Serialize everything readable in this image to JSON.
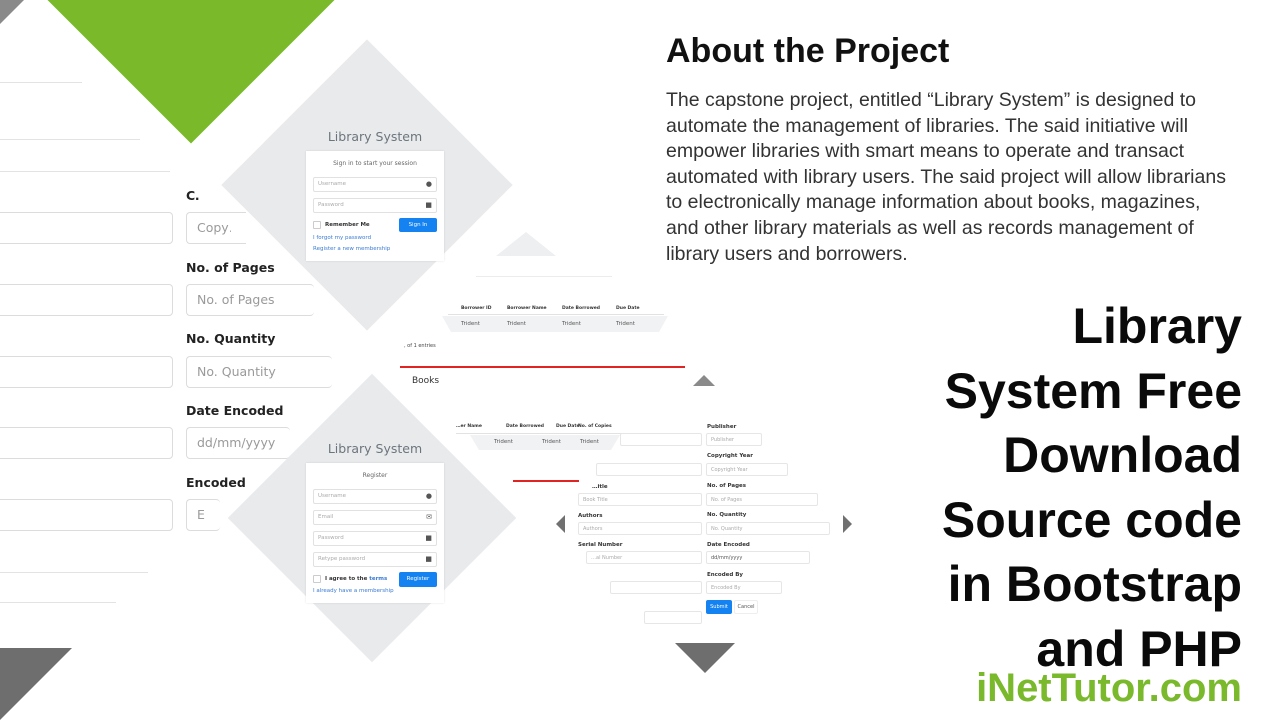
{
  "colors": {
    "accent_green": "#7ab929",
    "diamond_gray": "#e9eaec",
    "primary_blue": "#1482f0",
    "arrow_gray": "#707070",
    "red_line": "#e02424"
  },
  "left_form": {
    "fields": [
      {
        "label": "C…",
        "placeholder": "Copy…"
      },
      {
        "label": "No. of Pages",
        "placeholder": "No. of Pages"
      },
      {
        "label": "No. Quantity",
        "placeholder": "No. Quantity"
      },
      {
        "label": "Date Encoded",
        "placeholder": "dd/mm/yyyy"
      },
      {
        "label": "Encoded",
        "placeholder": "E"
      }
    ]
  },
  "login_card": {
    "title": "Library System",
    "subtitle": "Sign in to start your session",
    "username_placeholder": "Username",
    "password_placeholder": "Password",
    "remember_label": "Remember Me",
    "signin_button": "Sign In",
    "forgot_link": "I forgot my password",
    "register_link": "Register a new membership",
    "icons": {
      "username": "user-icon",
      "password": "lock-icon"
    }
  },
  "register_card": {
    "title": "Library System",
    "subtitle": "Register",
    "username_placeholder": "Username",
    "email_placeholder": "Email",
    "password_placeholder": "Password",
    "retype_placeholder": "Retype password",
    "agree_label": "I agree to the ",
    "terms_link": "terms",
    "register_button": "Register",
    "membership_link": "I already have a membership",
    "icons": {
      "username": "user-icon",
      "email": "envelope-icon",
      "password": "lock-icon",
      "retype": "lock-icon"
    }
  },
  "borrow_table": {
    "columns": [
      "Borrower ID",
      "Borrower Name",
      "Date Borrowed",
      "Due Date"
    ],
    "row": [
      "Trident",
      "Trident",
      "Trident",
      "Trident"
    ],
    "footer": ", of 1 entries",
    "section_title": "Books"
  },
  "books_table": {
    "columns": [
      "…er Name",
      "Date Borrowed",
      "Due Date",
      "No. of Copies"
    ],
    "row": [
      "Trident",
      "Trident",
      "Trident"
    ]
  },
  "book_form": {
    "left_fields": [
      {
        "label": "…itle",
        "placeholder": "Book Title"
      },
      {
        "label": "Authors",
        "placeholder": "Authors"
      },
      {
        "label": "Serial Number",
        "placeholder": "…al Number"
      }
    ],
    "right_fields": [
      {
        "label": "Publisher",
        "placeholder": "Publisher"
      },
      {
        "label": "Copyright Year",
        "placeholder": "Copyright Year"
      },
      {
        "label": "No. of Pages",
        "placeholder": "No. of Pages"
      },
      {
        "label": "No. Quantity",
        "placeholder": "No. Quantity"
      },
      {
        "label": "Date Encoded",
        "placeholder": "dd/mm/yyyy"
      },
      {
        "label": "Encoded By",
        "placeholder": "Encoded By"
      }
    ],
    "submit_button": "Submit",
    "cancel_button": "Cancel"
  },
  "about": {
    "title": "About the Project",
    "body": "The capstone project, entitled “Library System” is designed to automate the management  of libraries. The said initiative will empower libraries with smart means to operate and transact automated with library users. The said project will allow librarians to electronically manage information about books, magazines,  and other library materials as well as records management  of library users and borrowers."
  },
  "headline": {
    "lines": [
      "Library",
      "System Free",
      "Download",
      "Source code",
      "in Bootstrap",
      "and PHP"
    ]
  },
  "brand": "iNetTutor.com"
}
